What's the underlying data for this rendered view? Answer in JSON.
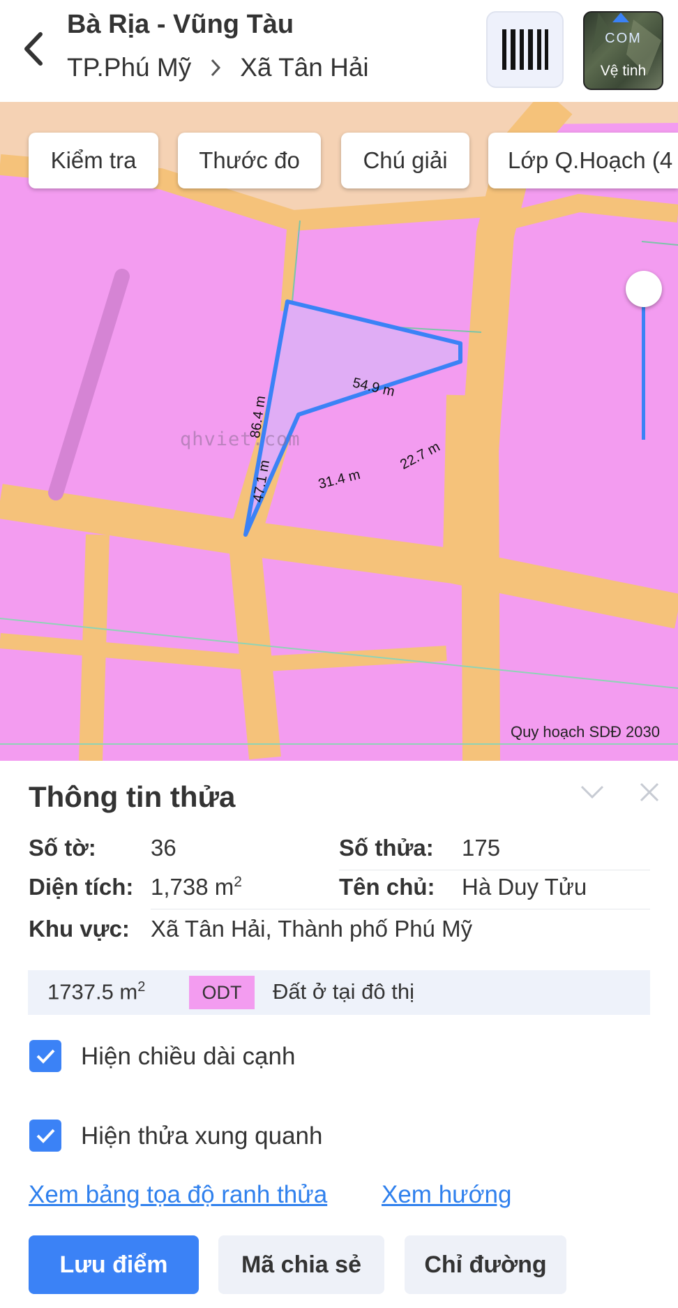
{
  "header": {
    "title": "Bà Rịa - Vũng Tàu",
    "breadcrumb": {
      "city": "TP.Phú Mỹ",
      "commune": "Xã Tân Hải"
    },
    "satellite": {
      "brand_text": "COM",
      "label": "Vệ tinh"
    }
  },
  "map": {
    "toolbar": [
      "Kiểm tra",
      "Thước đo",
      "Chú giải",
      "Lớp Q.Hoạch (4"
    ],
    "watermark": "qhviet.com",
    "layer_caption": "Quy hoạch SDĐ 2030",
    "edge_lengths": {
      "top": "54.9 m",
      "right_short": "22.7 m",
      "inner": "31.4 m",
      "left_upper": "86.4 m",
      "left_lower": "47.1 m"
    },
    "colors": {
      "residential_land": "#f39cf0",
      "road": "#f5c27a",
      "selected_parcel_fill": "#e0adf5",
      "parcel_outline": "#3b82f6"
    }
  },
  "parcel": {
    "title": "Thông tin thửa",
    "so_to_label": "Số tờ:",
    "so_to_value": "36",
    "so_thua_label": "Số thửa:",
    "so_thua_value": "175",
    "dien_tich_label": "Diện tích:",
    "dien_tich_value": "1,738 m",
    "dien_tich_unit_sup": "2",
    "ten_chu_label": "Tên chủ:",
    "ten_chu_value": "Hà Duy Tửu",
    "khu_vuc_label": "Khu vực:",
    "khu_vuc_value": "Xã Tân Hải, Thành phố Phú Mỹ",
    "land_use": {
      "area": "1737.5 m",
      "area_unit_sup": "2",
      "code": "ODT",
      "description": "Đất ở tại đô thị"
    },
    "options": {
      "show_edge_lengths": {
        "label": "Hiện chiều dài cạnh",
        "checked": true
      },
      "show_surrounding": {
        "label": "Hiện thửa xung quanh",
        "checked": true
      }
    },
    "links": {
      "coordinates": "Xem bảng tọa độ ranh thửa",
      "direction": "Xem hướng"
    },
    "buttons": {
      "save_point": "Lưu điểm",
      "share_code": "Mã chia sẻ",
      "directions": "Chỉ đường"
    }
  }
}
